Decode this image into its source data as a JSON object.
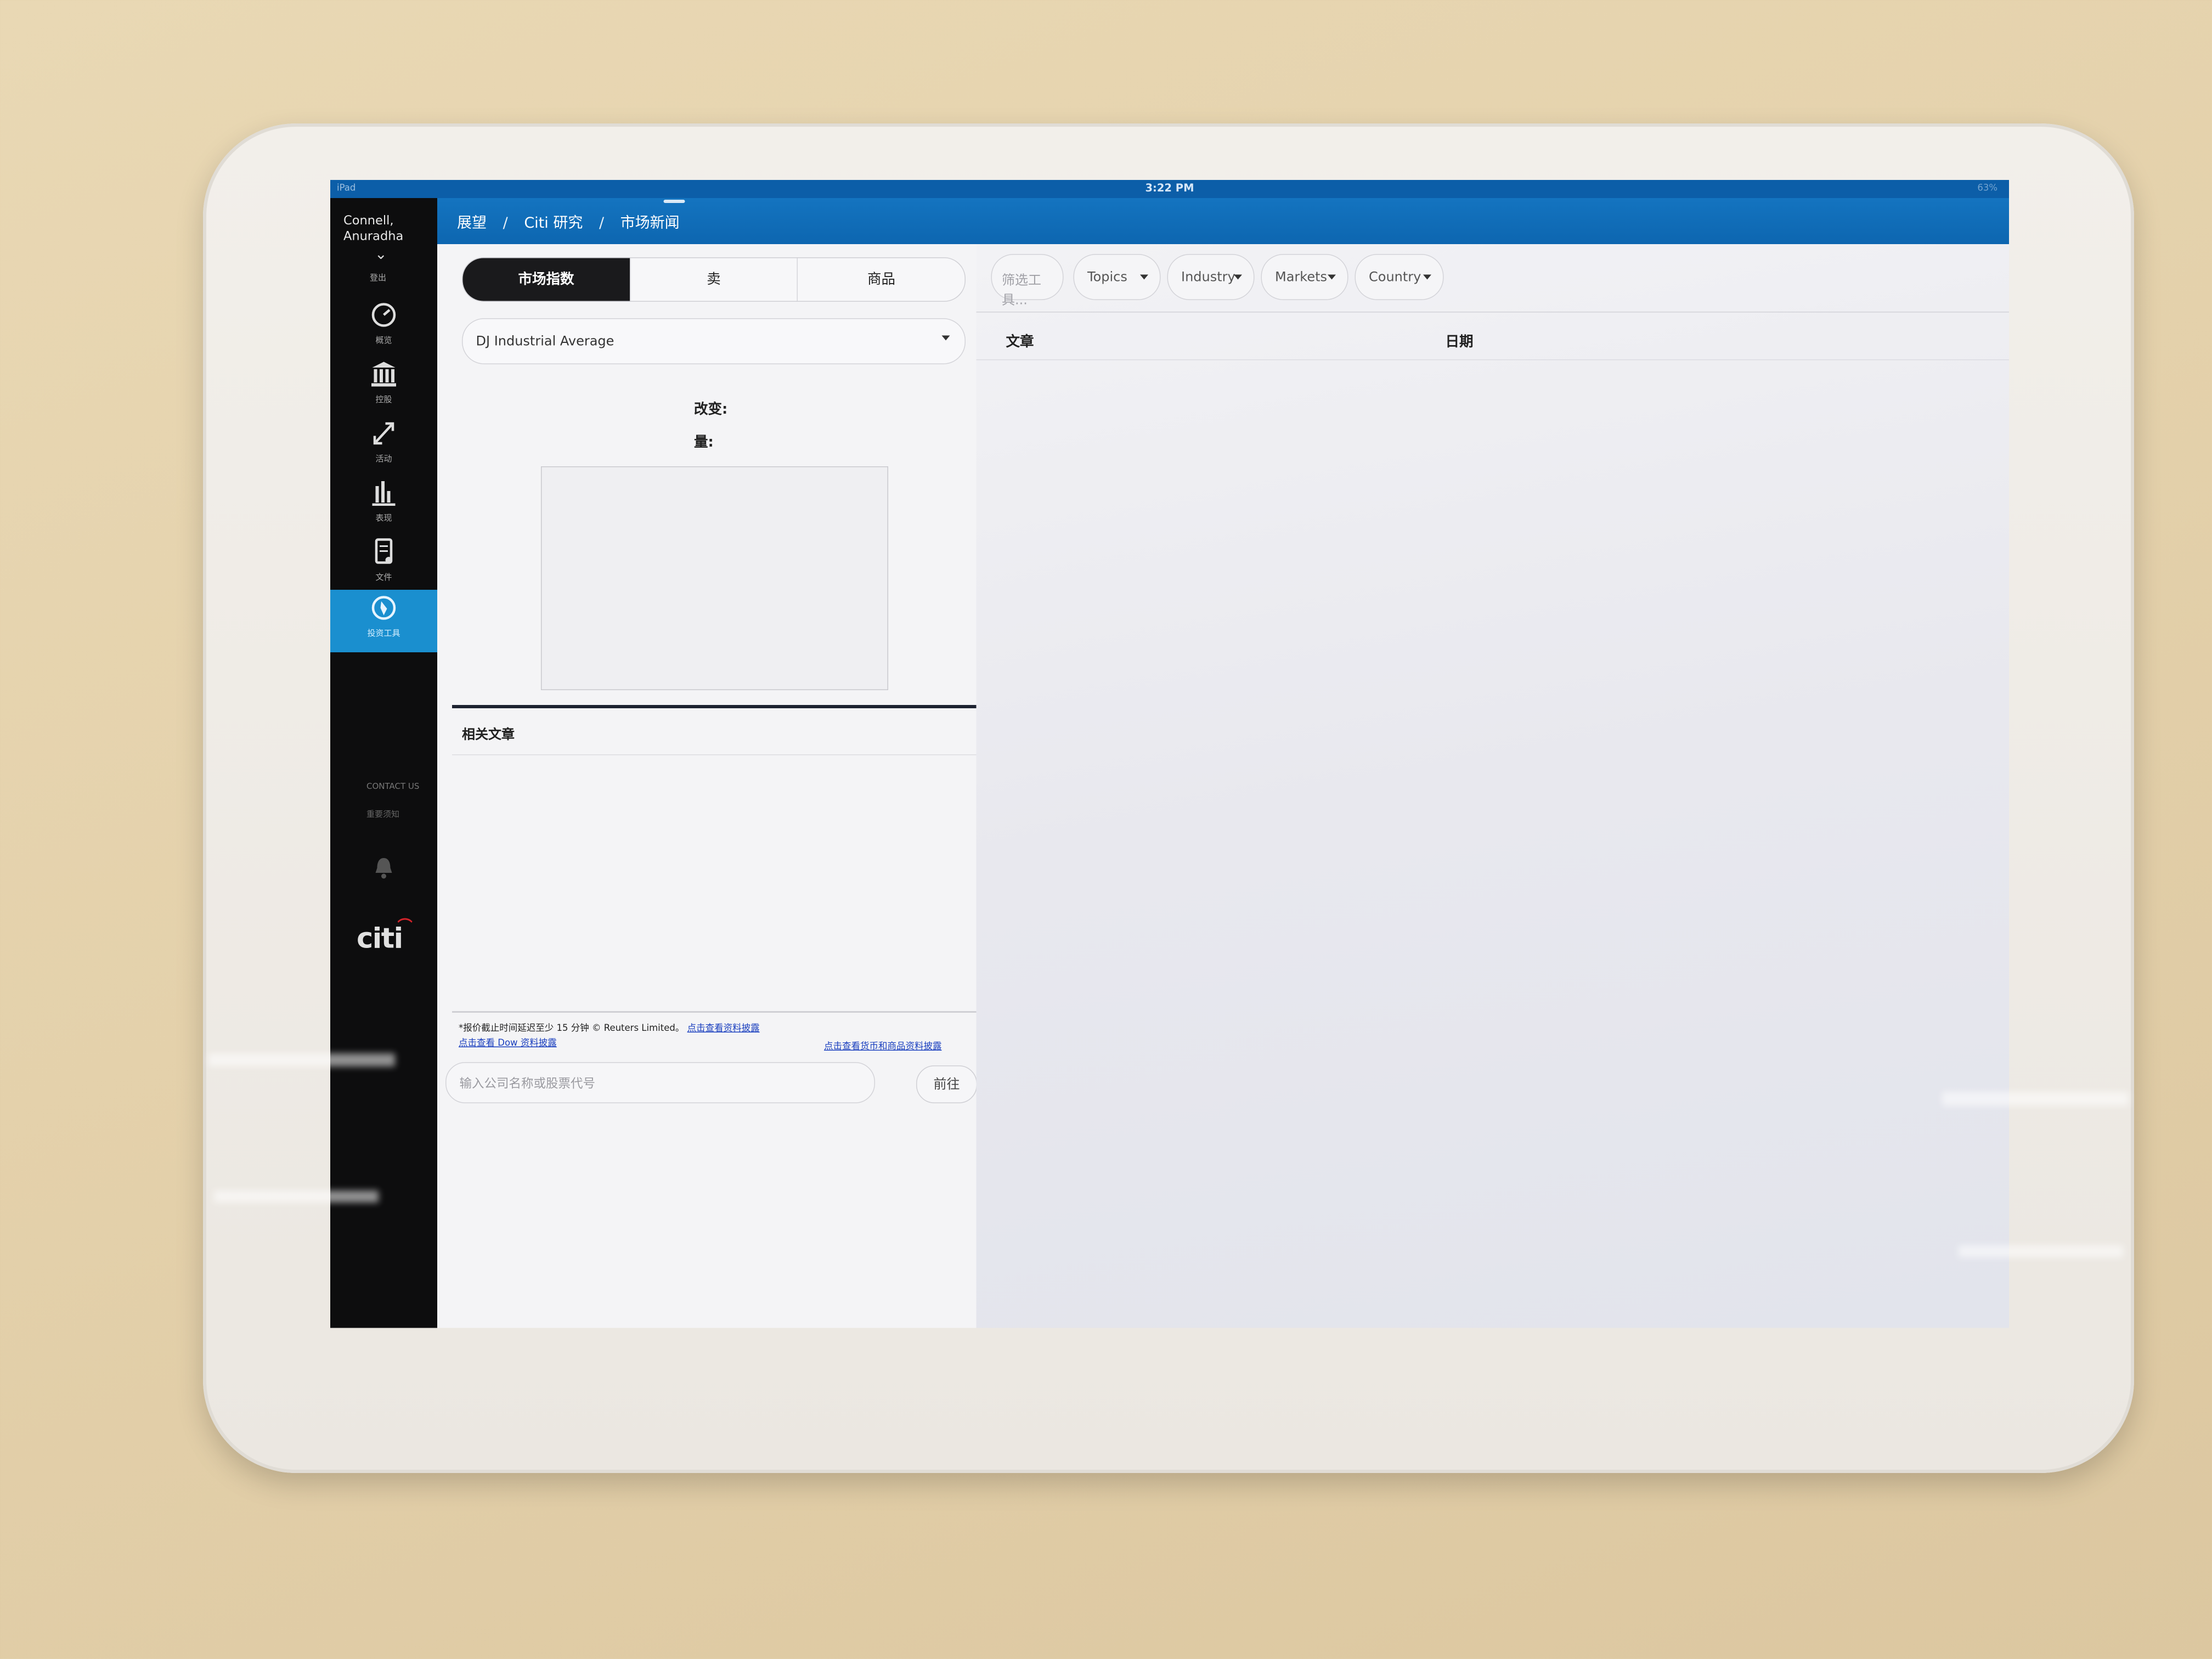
{
  "status_bar": {
    "left": "iPad",
    "time": "3:22 PM",
    "battery": "63%"
  },
  "sidebar": {
    "user_name": "Connell, Anuradha",
    "logout": "登出",
    "items": [
      {
        "label": "概览",
        "icon": "gauge-icon"
      },
      {
        "label": "控股",
        "icon": "bank-icon"
      },
      {
        "label": "活动",
        "icon": "arrows-icon"
      },
      {
        "label": "表现",
        "icon": "bar-chart-icon"
      },
      {
        "label": "文件",
        "icon": "document-icon"
      },
      {
        "label": "投资工具",
        "icon": "compass-icon",
        "active": true
      }
    ],
    "contact": "CONTACT US",
    "notice": "重要须知",
    "logo": "citi"
  },
  "breadcrumb": {
    "items": [
      "展望",
      "Citi 研究",
      "市场新闻"
    ],
    "separator": "/"
  },
  "left_panel": {
    "tabs": [
      "市场指数",
      "卖",
      "商品"
    ],
    "active_tab": "市场指数",
    "index_select": "DJ Industrial Average",
    "change_label": "改变:",
    "volume_label": "量:",
    "related_articles": "相关文章",
    "disclaimer": "*报价截止时间延迟至少 15 分钟 © Reuters Limited。",
    "disclaimer_link": "点击查看资料披露",
    "dow_link": "点击查看 Dow 资料披露",
    "fx_link": "点击查看货币和商品资料披露",
    "search_placeholder": "输入公司名称或股票代号",
    "go_button": "前往"
  },
  "right_panel": {
    "filter_tool_placeholder": "筛选工具...",
    "filters": [
      "Topics",
      "Industry",
      "Markets",
      "Country"
    ],
    "columns": {
      "article": "文章",
      "date": "日期"
    }
  },
  "colors": {
    "header_blue": "#0d66b0",
    "sidebar_bg": "#0d0d0e",
    "active_nav": "#1a8fcf"
  }
}
